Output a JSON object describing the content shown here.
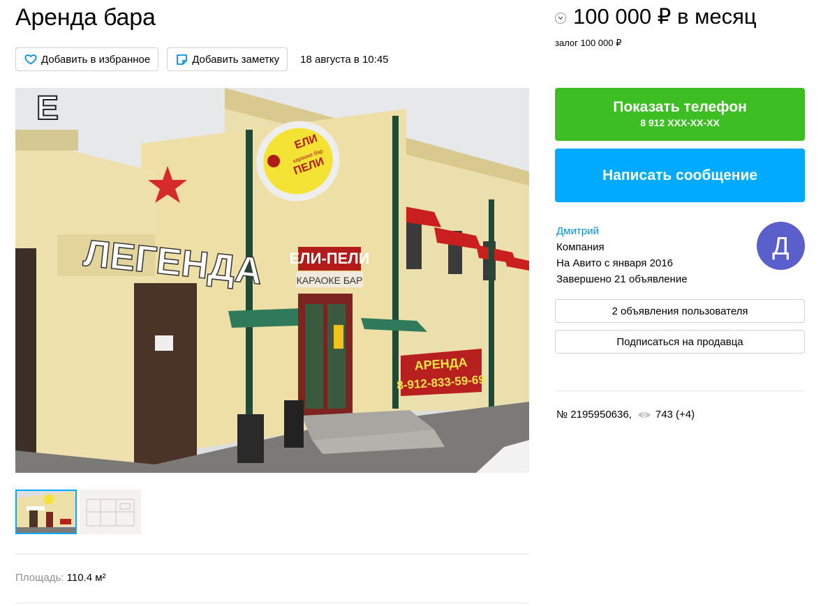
{
  "listing": {
    "title": "Аренда бара",
    "actions": {
      "favorite_label": "Добавить в избранное",
      "note_label": "Добавить заметку",
      "date": "18 августа в 10:45"
    },
    "photo": {
      "sign_legend": "ЛЕГЕНДА",
      "sign_eli": "ЕЛИ",
      "sign_peli": "ПЕЛИ",
      "sign_karaoke_small": "караоке бар",
      "sign_karaoke": "КАРАОКЕ БАР",
      "sign_eli_peli_red": "ЕЛИ-ПЕЛИ",
      "banner_title": "АРЕНДА",
      "banner_phone": "8-912-833-59-69"
    },
    "params": {
      "area_label": "Площадь:",
      "area_value": "110.4 м²"
    }
  },
  "sidebar": {
    "price": "100 000 ₽ в месяц",
    "deposit": "залог 100 000 ₽",
    "phone_button": {
      "label": "Показать телефон",
      "number": "8 912 XXX-XX-XX"
    },
    "message_button": "Написать сообщение",
    "seller": {
      "name": "Дмитрий",
      "type": "Компания",
      "since": "На Авито с января 2016",
      "completed": "Завершено 21 объявление",
      "avatar_letter": "Д"
    },
    "user_ads_button": "2 объявления пользователя",
    "subscribe_button": "Подписаться на продавца",
    "ad_number": "№ 2195950636,",
    "views": "743 (+4)"
  },
  "colors": {
    "green": "#3dbf24",
    "blue": "#00aaff",
    "link": "#0091d9",
    "avatar": "#5a5fcb"
  }
}
